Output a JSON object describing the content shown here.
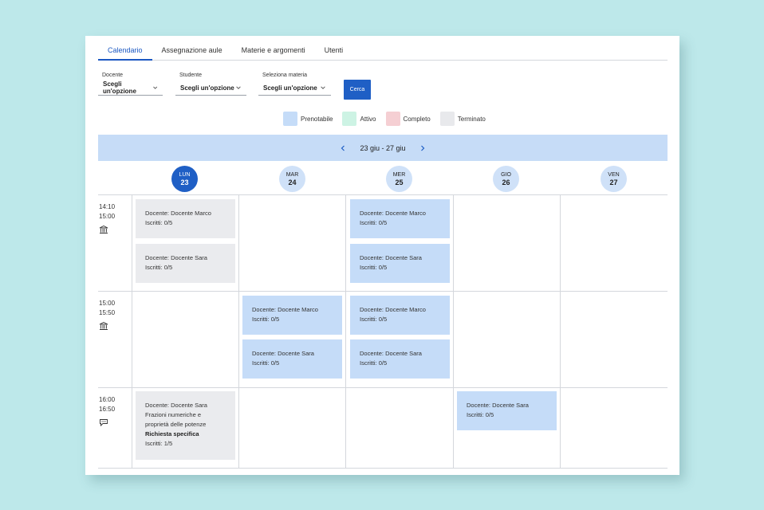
{
  "tabs": [
    {
      "label": "Calendario",
      "active": true
    },
    {
      "label": "Assegnazione aule",
      "active": false
    },
    {
      "label": "Materie e argomenti",
      "active": false
    },
    {
      "label": "Utenti",
      "active": false
    }
  ],
  "filters": {
    "docente": {
      "label": "Docente",
      "value": "Scegli un'opzione"
    },
    "studente": {
      "label": "Studente",
      "value": "Scegli un'opzione"
    },
    "materia": {
      "label": "Seleziona materia",
      "value": "Scegli un'opzione"
    },
    "search_label": "Cerca"
  },
  "legend": [
    {
      "label": "Prenotabile",
      "color": "#c5dcf8"
    },
    {
      "label": "Attivo",
      "color": "#cdf3e4"
    },
    {
      "label": "Completo",
      "color": "#f5cfd3"
    },
    {
      "label": "Terminato",
      "color": "#e8e9ec"
    }
  ],
  "week": {
    "range": "23 giu - 27 giu"
  },
  "days": [
    {
      "name": "LUN",
      "num": "23",
      "active": true
    },
    {
      "name": "MAR",
      "num": "24",
      "active": false
    },
    {
      "name": "MER",
      "num": "25",
      "active": false
    },
    {
      "name": "GIO",
      "num": "26",
      "active": false
    },
    {
      "name": "VEN",
      "num": "27",
      "active": false
    }
  ],
  "slots": [
    {
      "start": "14:10",
      "end": "15:00",
      "icon": "building-icon"
    },
    {
      "start": "15:00",
      "end": "15:50",
      "icon": "building-icon"
    },
    {
      "start": "16:00",
      "end": "16:50",
      "icon": "chat-icon"
    }
  ],
  "events": {
    "e1": {
      "docente": "Docente: Docente Marco",
      "iscritti": "Iscritti: 0/5"
    },
    "e2": {
      "docente": "Docente: Docente Sara",
      "iscritti": "Iscritti: 0/5"
    },
    "e3": {
      "docente": "Docente: Docente Marco",
      "iscritti": "Iscritti: 0/5"
    },
    "e4": {
      "docente": "Docente: Docente Sara",
      "iscritti": "Iscritti: 0/5"
    },
    "e5": {
      "docente": "Docente: Docente Marco",
      "iscritti": "Iscritti: 0/5"
    },
    "e6": {
      "docente": "Docente: Docente Marco",
      "iscritti": "Iscritti: 0/5"
    },
    "e7": {
      "docente": "Docente: Docente Sara",
      "iscritti": "Iscritti: 0/5"
    },
    "e8": {
      "docente": "Docente: Docente Sara",
      "iscritti": "Iscritti: 0/5"
    },
    "e9": {
      "docente": "Docente: Docente Sara",
      "topic_line1": "Frazioni numeriche e",
      "topic_line2": "proprietà delle potenze",
      "request": "Richiesta specifica",
      "iscritti": "Iscritti: 1/5"
    },
    "e10": {
      "docente": "Docente: Docente Sara",
      "iscritti": "Iscritti: 0/5"
    }
  }
}
